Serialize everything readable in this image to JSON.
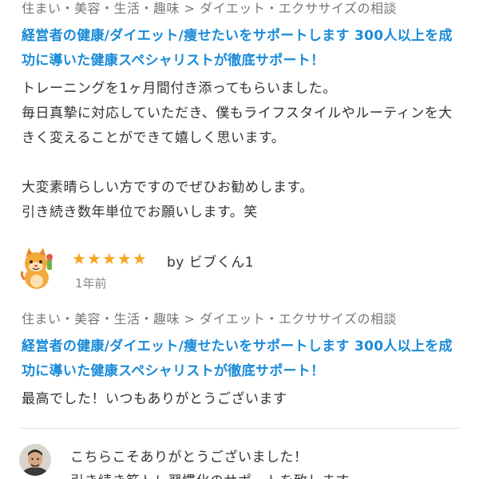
{
  "review_top": {
    "category": "住まい・美容・生活・趣味 > ダイエット・エクササイズの相談",
    "service_title": "経営者の健康/ダイエット/痩せたいをサポートします 300人以上を成功に導いた健康スペシャリストが徹底サポート！",
    "body": "トレーニングを1ヶ月間付き添ってもらいました。\n毎日真摯に対応していただき、僕もライフスタイルやルーティンを大きく変えることができて嬉しく思います。\n\n大変素晴らしい方ですのでぜひお勧めします。\n引き続き数年単位でお願いします。笑"
  },
  "review_second": {
    "rating": 5,
    "stars_text": "★★★★★",
    "reviewer": "by ビブくん1",
    "age": "1年前",
    "avatar_icon": "cat-mascot-icon",
    "category": "住まい・美容・生活・趣味 > ダイエット・エクササイズの相談",
    "service_title": "経営者の健康/ダイエット/痩せたいをサポートします 300人以上を成功に導いた健康スペシャリストが徹底サポート！",
    "body": "最高でした！いつもありがとうございます"
  },
  "reply": {
    "avatar_icon": "seller-avatar-icon",
    "text": "こちらこそありがとうございました！\n引き続き筋トレ習慣化のサポートを致します"
  },
  "colors": {
    "link": "#1a8bd8",
    "star": "#f5a623",
    "muted": "#777777"
  }
}
